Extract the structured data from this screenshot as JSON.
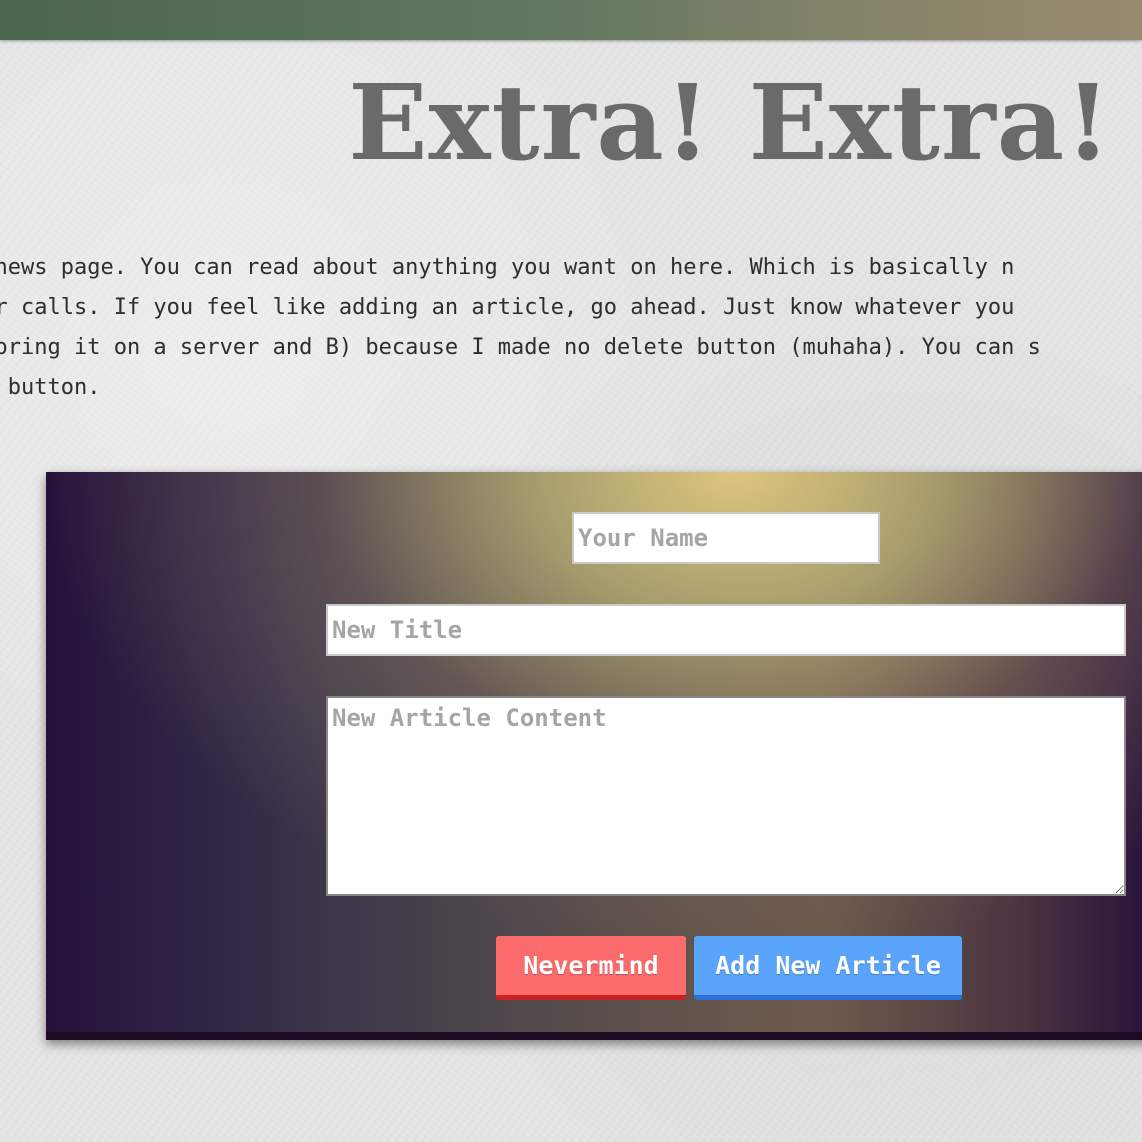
{
  "header": {
    "title": "Extra! Extra!"
  },
  "intro": {
    "lines": [
      "y news page. You can read about anything you want on here. Which is basically n",
      "ver calls. If you feel like adding an article, go ahead. Just know whatever you",
      "storing it on a server and B) because I made no delete button (muhaha). You can s",
      "he button."
    ]
  },
  "form": {
    "name_placeholder": "Your Name",
    "title_placeholder": "New Title",
    "content_placeholder": "New Article Content",
    "cancel_label": "Nevermind",
    "submit_label": "Add New Article"
  },
  "colors": {
    "top_bar": "#5f7660",
    "title_text": "#6a6a6a",
    "cancel_button": "#fb6b6b",
    "submit_button": "#5aa5fb"
  }
}
